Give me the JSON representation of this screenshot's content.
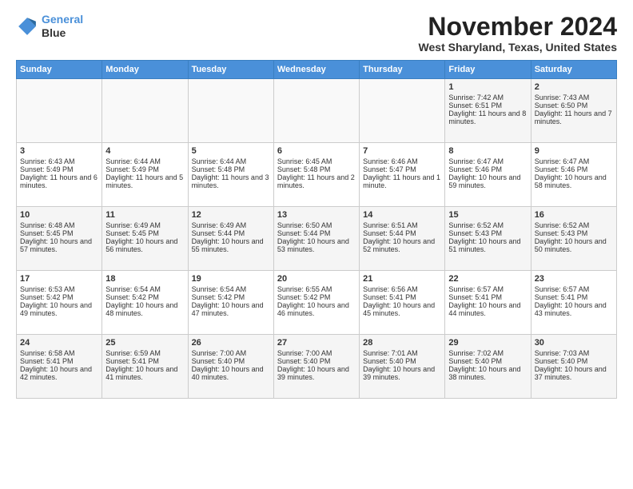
{
  "app": {
    "logo_line1": "General",
    "logo_line2": "Blue"
  },
  "header": {
    "month": "November 2024",
    "location": "West Sharyland, Texas, United States"
  },
  "days_of_week": [
    "Sunday",
    "Monday",
    "Tuesday",
    "Wednesday",
    "Thursday",
    "Friday",
    "Saturday"
  ],
  "weeks": [
    [
      {
        "day": "",
        "content": ""
      },
      {
        "day": "",
        "content": ""
      },
      {
        "day": "",
        "content": ""
      },
      {
        "day": "",
        "content": ""
      },
      {
        "day": "",
        "content": ""
      },
      {
        "day": "1",
        "content": "Sunrise: 7:42 AM\nSunset: 6:51 PM\nDaylight: 11 hours and 8 minutes."
      },
      {
        "day": "2",
        "content": "Sunrise: 7:43 AM\nSunset: 6:50 PM\nDaylight: 11 hours and 7 minutes."
      }
    ],
    [
      {
        "day": "3",
        "content": "Sunrise: 6:43 AM\nSunset: 5:49 PM\nDaylight: 11 hours and 6 minutes."
      },
      {
        "day": "4",
        "content": "Sunrise: 6:44 AM\nSunset: 5:49 PM\nDaylight: 11 hours and 5 minutes."
      },
      {
        "day": "5",
        "content": "Sunrise: 6:44 AM\nSunset: 5:48 PM\nDaylight: 11 hours and 3 minutes."
      },
      {
        "day": "6",
        "content": "Sunrise: 6:45 AM\nSunset: 5:48 PM\nDaylight: 11 hours and 2 minutes."
      },
      {
        "day": "7",
        "content": "Sunrise: 6:46 AM\nSunset: 5:47 PM\nDaylight: 11 hours and 1 minute."
      },
      {
        "day": "8",
        "content": "Sunrise: 6:47 AM\nSunset: 5:46 PM\nDaylight: 10 hours and 59 minutes."
      },
      {
        "day": "9",
        "content": "Sunrise: 6:47 AM\nSunset: 5:46 PM\nDaylight: 10 hours and 58 minutes."
      }
    ],
    [
      {
        "day": "10",
        "content": "Sunrise: 6:48 AM\nSunset: 5:45 PM\nDaylight: 10 hours and 57 minutes."
      },
      {
        "day": "11",
        "content": "Sunrise: 6:49 AM\nSunset: 5:45 PM\nDaylight: 10 hours and 56 minutes."
      },
      {
        "day": "12",
        "content": "Sunrise: 6:49 AM\nSunset: 5:44 PM\nDaylight: 10 hours and 55 minutes."
      },
      {
        "day": "13",
        "content": "Sunrise: 6:50 AM\nSunset: 5:44 PM\nDaylight: 10 hours and 53 minutes."
      },
      {
        "day": "14",
        "content": "Sunrise: 6:51 AM\nSunset: 5:44 PM\nDaylight: 10 hours and 52 minutes."
      },
      {
        "day": "15",
        "content": "Sunrise: 6:52 AM\nSunset: 5:43 PM\nDaylight: 10 hours and 51 minutes."
      },
      {
        "day": "16",
        "content": "Sunrise: 6:52 AM\nSunset: 5:43 PM\nDaylight: 10 hours and 50 minutes."
      }
    ],
    [
      {
        "day": "17",
        "content": "Sunrise: 6:53 AM\nSunset: 5:42 PM\nDaylight: 10 hours and 49 minutes."
      },
      {
        "day": "18",
        "content": "Sunrise: 6:54 AM\nSunset: 5:42 PM\nDaylight: 10 hours and 48 minutes."
      },
      {
        "day": "19",
        "content": "Sunrise: 6:54 AM\nSunset: 5:42 PM\nDaylight: 10 hours and 47 minutes."
      },
      {
        "day": "20",
        "content": "Sunrise: 6:55 AM\nSunset: 5:42 PM\nDaylight: 10 hours and 46 minutes."
      },
      {
        "day": "21",
        "content": "Sunrise: 6:56 AM\nSunset: 5:41 PM\nDaylight: 10 hours and 45 minutes."
      },
      {
        "day": "22",
        "content": "Sunrise: 6:57 AM\nSunset: 5:41 PM\nDaylight: 10 hours and 44 minutes."
      },
      {
        "day": "23",
        "content": "Sunrise: 6:57 AM\nSunset: 5:41 PM\nDaylight: 10 hours and 43 minutes."
      }
    ],
    [
      {
        "day": "24",
        "content": "Sunrise: 6:58 AM\nSunset: 5:41 PM\nDaylight: 10 hours and 42 minutes."
      },
      {
        "day": "25",
        "content": "Sunrise: 6:59 AM\nSunset: 5:41 PM\nDaylight: 10 hours and 41 minutes."
      },
      {
        "day": "26",
        "content": "Sunrise: 7:00 AM\nSunset: 5:40 PM\nDaylight: 10 hours and 40 minutes."
      },
      {
        "day": "27",
        "content": "Sunrise: 7:00 AM\nSunset: 5:40 PM\nDaylight: 10 hours and 39 minutes."
      },
      {
        "day": "28",
        "content": "Sunrise: 7:01 AM\nSunset: 5:40 PM\nDaylight: 10 hours and 39 minutes."
      },
      {
        "day": "29",
        "content": "Sunrise: 7:02 AM\nSunset: 5:40 PM\nDaylight: 10 hours and 38 minutes."
      },
      {
        "day": "30",
        "content": "Sunrise: 7:03 AM\nSunset: 5:40 PM\nDaylight: 10 hours and 37 minutes."
      }
    ]
  ]
}
